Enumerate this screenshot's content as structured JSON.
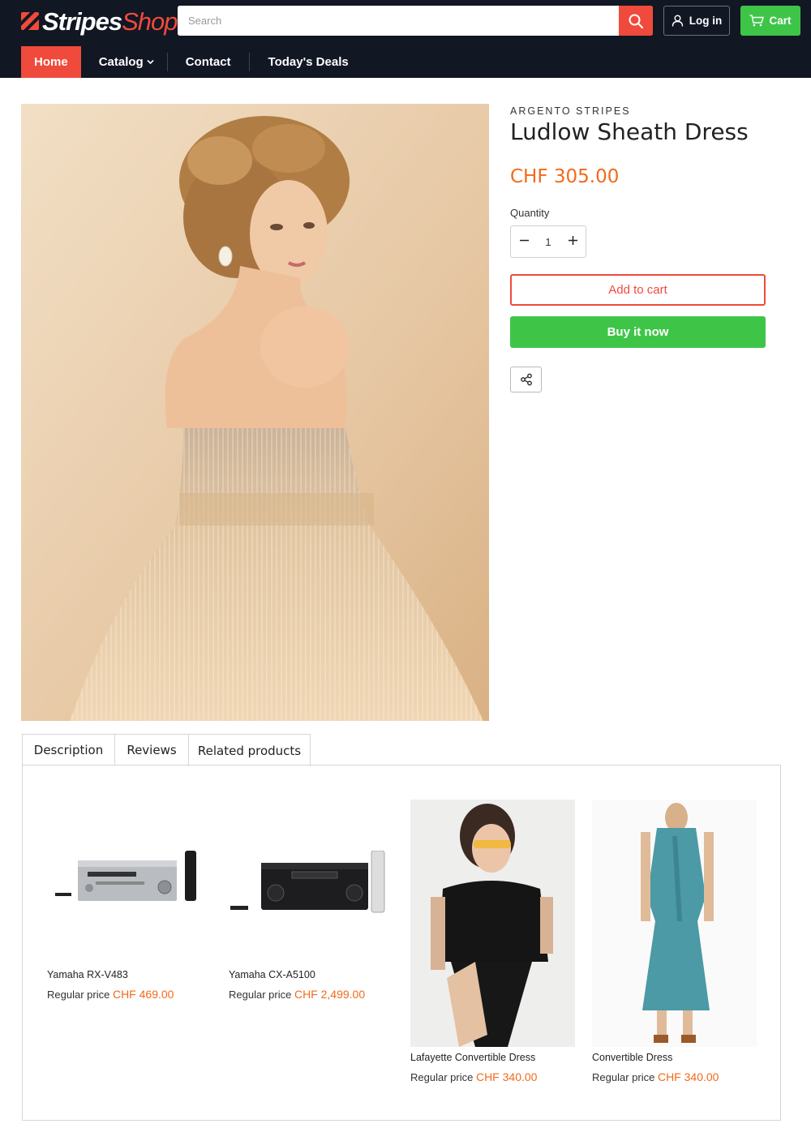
{
  "header": {
    "logo": {
      "part1": "Stripes",
      "part2": "Shop"
    },
    "search": {
      "placeholder": "Search"
    },
    "login_label": "Log in",
    "cart_label": "Cart"
  },
  "nav": {
    "items": [
      {
        "label": "Home",
        "active": true
      },
      {
        "label": "Catalog",
        "has_dropdown": true
      },
      {
        "label": "Contact"
      },
      {
        "label": "Today's Deals"
      }
    ]
  },
  "product": {
    "vendor": "ARGENTO STRIPES",
    "title": "Ludlow Sheath Dress",
    "price": "CHF 305.00",
    "quantity_label": "Quantity",
    "quantity": "1",
    "add_to_cart": "Add to cart",
    "buy_now": "Buy it now"
  },
  "tabs": [
    {
      "label": "Description"
    },
    {
      "label": "Reviews"
    },
    {
      "label": "Related products",
      "active": true
    }
  ],
  "related_products": [
    {
      "name": "Yamaha RX-V483",
      "price_prefix": "Regular price",
      "price": "CHF 469.00"
    },
    {
      "name": "Yamaha CX-A5100",
      "price_prefix": "Regular price",
      "price": "CHF 2,499.00"
    },
    {
      "name": "Lafayette Convertible Dress",
      "price_prefix": "Regular price",
      "price": "CHF 340.00"
    },
    {
      "name": "Convertible Dress",
      "price_prefix": "Regular price",
      "price": "CHF 340.00"
    }
  ],
  "colors": {
    "header_bg": "#111723",
    "accent_red": "#f04a3c",
    "accent_green": "#3ec548",
    "price_orange": "#f26a1b"
  }
}
